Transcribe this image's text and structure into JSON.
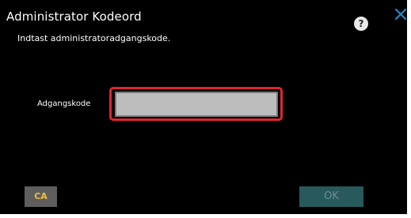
{
  "dialog": {
    "title": "Administrator Kodeord",
    "instruction": "Indtast administratoradgangskode.",
    "help_label": "?",
    "close_icon": "close-x-icon",
    "password_label": "Adgangskode",
    "password_value": "",
    "ca_label": "CA",
    "ok_label": "OK",
    "ok_enabled": false
  },
  "colors": {
    "background": "#000000",
    "highlight": "#e1252f",
    "ca_text": "#f5bd3c",
    "ok_background": "#27595d",
    "close_icon": "#1a8fc9"
  }
}
